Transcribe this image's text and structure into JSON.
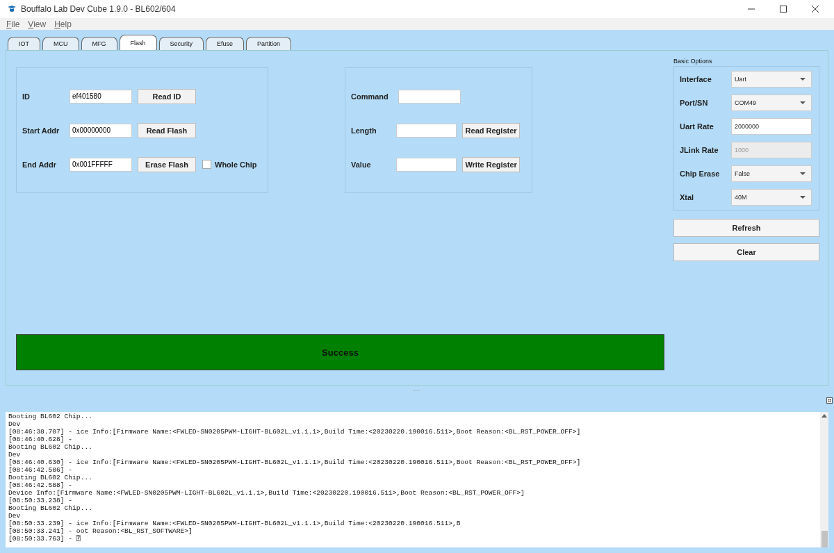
{
  "window": {
    "title": "Bouffalo Lab Dev Cube 1.9.0 - BL602/604"
  },
  "menu": [
    "File",
    "View",
    "Help"
  ],
  "tabs": [
    {
      "label": "IOT",
      "selected": false
    },
    {
      "label": "MCU",
      "selected": false
    },
    {
      "label": "MFG",
      "selected": false
    },
    {
      "label": "Flash",
      "selected": true
    },
    {
      "label": "Security",
      "selected": false
    },
    {
      "label": "Efuse",
      "selected": false
    },
    {
      "label": "Partition",
      "selected": false
    }
  ],
  "flash_group": {
    "rows": [
      {
        "label": "ID",
        "value": "ef401580",
        "button": "Read ID"
      },
      {
        "label": "Start Addr",
        "value": "0x00000000",
        "button": "Read Flash"
      },
      {
        "label": "End Addr",
        "value": "0x001FFFFF",
        "button": "Erase Flash",
        "checkbox": {
          "label": "Whole Chip",
          "checked": false
        }
      }
    ]
  },
  "register_group": {
    "rows": [
      {
        "label": "Command"
      },
      {
        "label": "Length",
        "button": "Read Register"
      },
      {
        "label": "Value",
        "button": "Write Register"
      }
    ]
  },
  "status": {
    "text": "Success",
    "error": false
  },
  "basic_options": {
    "title": "Basic Options",
    "fields": [
      {
        "label": "Interface",
        "value": "Uart",
        "kind": "dropdown"
      },
      {
        "label": "Port/SN",
        "value": "COM49",
        "kind": "dropdown"
      },
      {
        "label": "Uart Rate",
        "value": "2000000",
        "kind": "input",
        "disabled": false
      },
      {
        "label": "JLink Rate",
        "value": "1000",
        "kind": "input",
        "disabled": true
      },
      {
        "label": "Chip Erase",
        "value": "False",
        "kind": "dropdown"
      },
      {
        "label": "Xtal",
        "value": "40M",
        "kind": "dropdown"
      }
    ],
    "buttons": [
      "Refresh",
      "Clear"
    ]
  },
  "log": [
    "Booting BL602 Chip...",
    "Dev",
    "[08:46:38.707] - ice Info:[Firmware Name:<FWLED-SN0205PWM-LIGHT-BL602L_v1.1.1>,Build Time:<20230220.190016.511>,Boot Reason:<BL_RST_POWER_OFF>]",
    "[08:46:40.628] -",
    "Booting BL602 Chip...",
    "Dev",
    "[08:46:40.630] - ice Info:[Firmware Name:<FWLED-SN0205PWM-LIGHT-BL602L_v1.1.1>,Build Time:<20230220.190016.511>,Boot Reason:<BL_RST_POWER_OFF>]",
    "[08:46:42.586] -",
    "Booting BL602 Chip...",
    "[08:46:42.588] -",
    "Device Info:[Firmware Name:<FWLED-SN0205PWM-LIGHT-BL602L_v1.1.1>,Build Time:<20230220.190016.511>,Boot Reason:<BL_RST_POWER_OFF>]",
    "[08:50:33.238] -",
    "Booting BL602 Chip...",
    "Dev",
    "[08:50:33.239] - ice Info:[Firmware Name:<FWLED-SN0205PWM-LIGHT-BL602L_v1.1.1>,Build Time:<20230220.190016.511>,B",
    "[08:50:33.241] - oot Reason:<BL_RST_SOFTWARE>]",
    "[08:50:33.763] - ⍰"
  ]
}
